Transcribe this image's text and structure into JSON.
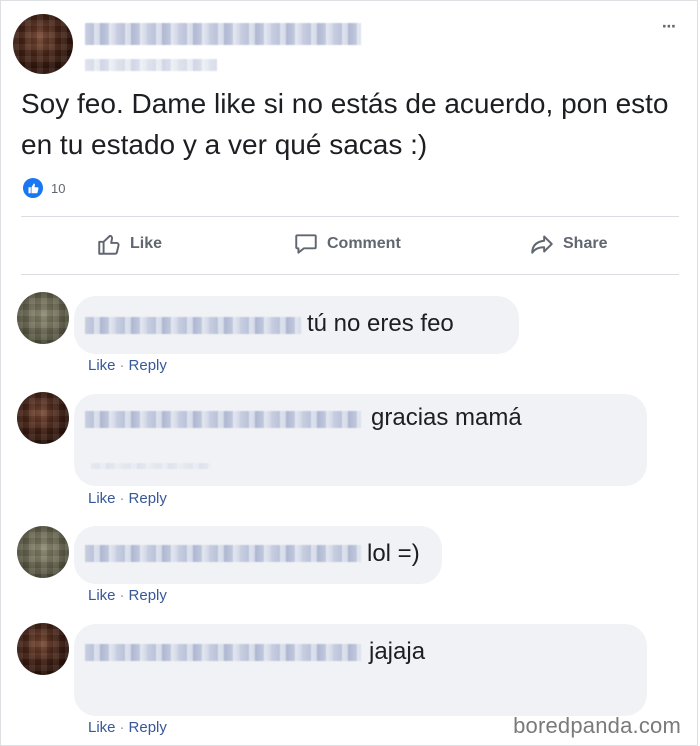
{
  "post": {
    "text": "Soy feo. Dame like si no estás de acuerdo, pon esto en tu estado y a ver qué sacas :)",
    "reaction_count": "10",
    "more_icon": "⋯"
  },
  "actions": {
    "like_label": "Like",
    "comment_label": "Comment",
    "share_label": "Share"
  },
  "comments": [
    {
      "avatar": "gray",
      "text": "tú no eres feo",
      "like_label": "Like",
      "reply_label": "Reply",
      "separator": "·"
    },
    {
      "avatar": "dark",
      "text": "gracias mamá",
      "like_label": "Like",
      "reply_label": "Reply",
      "separator": "·"
    },
    {
      "avatar": "gray",
      "text": "lol =)",
      "like_label": "Like",
      "reply_label": "Reply",
      "separator": "·"
    },
    {
      "avatar": "dark",
      "text": "jajaja",
      "like_label": "Like",
      "reply_label": "Reply",
      "separator": "·"
    }
  ],
  "watermark": "boredpanda.com",
  "colors": {
    "accent": "#1877f2",
    "link": "#385898",
    "bubble": "#f0f2f5",
    "action_text": "#606770"
  },
  "icons": {
    "like_badge": "thumbs-up-icon",
    "like_action": "thumbs-up-outline-icon",
    "comment_action": "speech-bubble-icon",
    "share_action": "share-arrow-icon",
    "more": "more-options-icon"
  }
}
